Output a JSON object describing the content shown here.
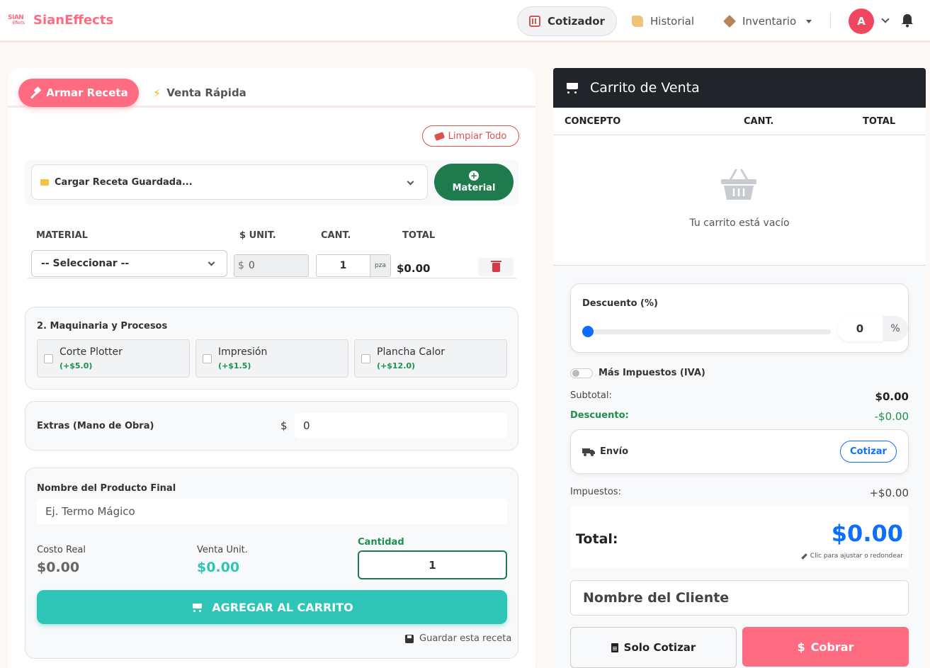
{
  "app": {
    "brand_logo": "SIAN",
    "brand_logo_sub": "Effects",
    "brand_name": "SianEffects"
  },
  "nav": {
    "cotizador": "Cotizador",
    "historial": "Historial",
    "inventario": "Inventario",
    "avatar_initial": "A"
  },
  "tabs": {
    "recipe": "Armar Receta",
    "quick": "Venta Rápida"
  },
  "recipe": {
    "clear_all": "Limpiar Todo",
    "load_placeholder": "Cargar Receta Guardada...",
    "add_material": "Material",
    "add_material_icon": "+"
  },
  "materials": {
    "headers": {
      "material": "MATERIAL",
      "unit": "$ UNIT.",
      "qty": "CANT.",
      "total": "TOTAL"
    },
    "row": {
      "select": "-- Seleccionar --",
      "currency": "$",
      "unit_price": "0",
      "qty": "1",
      "unit": "pza",
      "total": "$0.00"
    }
  },
  "machinery": {
    "title": "2. Maquinaria y Procesos",
    "items": [
      {
        "name": "Corte Plotter",
        "price": "(+$5.0)"
      },
      {
        "name": "Impresión",
        "price": "(+$1.5)"
      },
      {
        "name": "Plancha Calor",
        "price": "(+$12.0)"
      }
    ]
  },
  "extras": {
    "label": "Extras (Mano de Obra)",
    "currency": "$",
    "value": "0"
  },
  "product": {
    "name_label": "Nombre del Producto Final",
    "name_placeholder": "Ej. Termo Mágico",
    "cost_label": "Costo Real",
    "cost_value": "$0.00",
    "sale_label": "Venta Unit.",
    "sale_value": "$0.00",
    "qty_label": "Cantidad",
    "qty_value": "1",
    "add_to_cart": "AGREGAR AL CARRITO",
    "save_recipe": "Guardar esta receta"
  },
  "cart": {
    "title": "Carrito de Venta",
    "cols": {
      "concept": "CONCEPTO",
      "qty": "CANT.",
      "total": "TOTAL"
    },
    "empty": "Tu carrito está vacío",
    "discount_label": "Descuento (%)",
    "discount_value": "0",
    "discount_unit": "%",
    "discount_level": 0,
    "taxes_toggle": "Más Impuestos (IVA)",
    "subtotal_label": "Subtotal:",
    "subtotal_value": "$0.00",
    "discount_row_label": "Descuento:",
    "discount_row_value": "-$0.00",
    "shipping_label": "Envío",
    "shipping_button": "Cotizar",
    "taxes_label": "Impuestos:",
    "taxes_value": "+$0.00",
    "total_label": "Total:",
    "total_value": "$0.00",
    "total_hint": "Clic para ajustar o redondear",
    "client_placeholder": "Nombre del Cliente",
    "quote_only": "Solo Cotizar",
    "charge": "Cobrar",
    "charge_icon": "$"
  },
  "colors": {
    "brand": "#ff6b81",
    "primary": "#0d6efd",
    "teal": "#2ec4b6",
    "green": "#1f7a4d",
    "danger": "#dc3545",
    "dark": "#212529"
  }
}
